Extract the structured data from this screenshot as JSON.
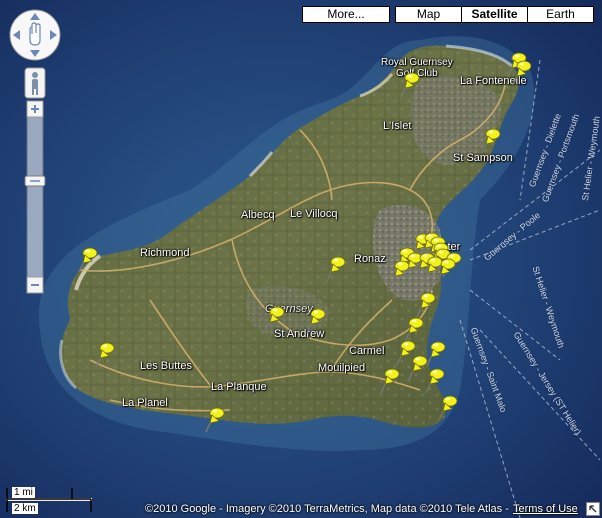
{
  "map": {
    "type_buttons": [
      {
        "label": "More...",
        "active": false
      },
      {
        "label": "Map",
        "active": false
      },
      {
        "label": "Satellite",
        "active": true
      },
      {
        "label": "Earth",
        "active": false
      }
    ],
    "places": [
      {
        "label": "Royal Guernsey"
      },
      {
        "label": "Golf Club"
      },
      {
        "label": "La Fontenelle"
      },
      {
        "label": "L'Islet"
      },
      {
        "label": "St Sampson"
      },
      {
        "label": "Albecq"
      },
      {
        "label": "Le Villocq"
      },
      {
        "label": "Richmond"
      },
      {
        "label": "Ronaz"
      },
      {
        "label": "Peter"
      },
      {
        "label": "Guernsey"
      },
      {
        "label": "St Andrew"
      },
      {
        "label": "Carmel"
      },
      {
        "label": "Mouilpied"
      },
      {
        "label": "Les Buttes"
      },
      {
        "label": "La Planque"
      },
      {
        "label": "La Planel"
      }
    ],
    "routes": [
      {
        "label": "Guernsey - Dielette"
      },
      {
        "label": "Guernsey - Portsmouth"
      },
      {
        "label": "St Helier - Weymouth"
      },
      {
        "label": "Guernsey - Poole"
      },
      {
        "label": "Guernsey - Saint Malo"
      },
      {
        "label": "Guernsey - Jersey (ST Helier)"
      },
      {
        "label": "St Helier - Weymouth"
      }
    ],
    "pin_count": 30,
    "pin_color": "#f2f21a",
    "scale": {
      "miles": "1 mi",
      "km": "2 km"
    },
    "copyright": "©2010 Google - Imagery ©2010 TerraMetrics, Map data ©2010 Tele Atlas -",
    "terms": "Terms of Use",
    "icons": [
      "pan-control-icon",
      "pegman-icon",
      "zoom-in-icon",
      "zoom-out-icon",
      "pushpin-icon",
      "expand-corner-icon"
    ]
  }
}
